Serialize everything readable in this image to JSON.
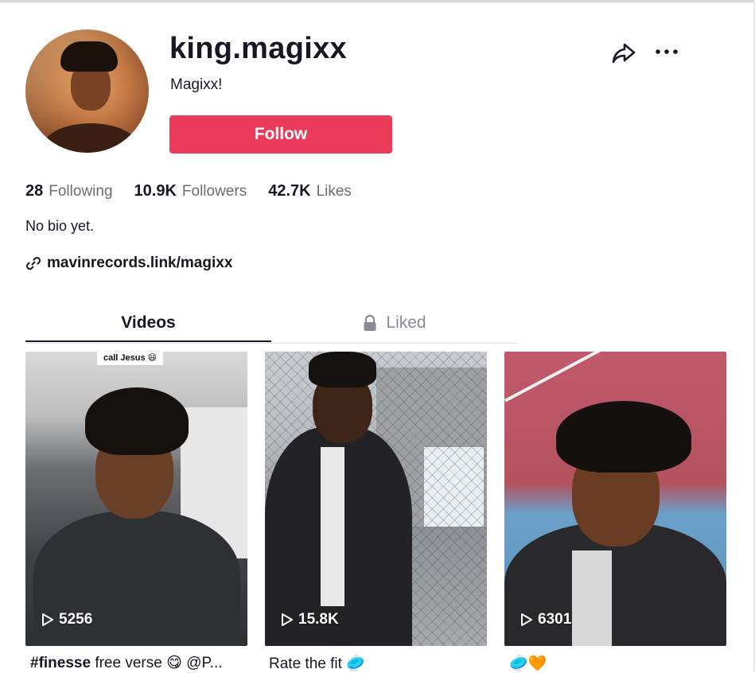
{
  "profile": {
    "username": "king.magixx",
    "nickname": "Magixx!",
    "follow_label": "Follow",
    "bio": "No bio yet.",
    "link": "mavinrecords.link/magixx"
  },
  "stats": [
    {
      "value": "28",
      "label": "Following"
    },
    {
      "value": "10.9K",
      "label": "Followers"
    },
    {
      "value": "42.7K",
      "label": "Likes"
    }
  ],
  "tabs": [
    {
      "label": "Videos",
      "active": true
    },
    {
      "label": "Liked",
      "locked": true
    }
  ],
  "videos": [
    {
      "plays": "5256",
      "overlay_text": "call Jesus 😄",
      "caption_tag": "#finesse",
      "caption_rest": " free verse 😋 @P..."
    },
    {
      "plays": "15.8K",
      "caption_tag": "",
      "caption_rest": "Rate the fit 🥏"
    },
    {
      "plays": "6301",
      "caption_tag": "",
      "caption_rest": "🥏🧡"
    }
  ],
  "icons": {
    "share": "share-icon",
    "more": "more-icon",
    "link": "link-icon",
    "lock": "lock-icon",
    "play": "play-icon"
  },
  "colors": {
    "follow_button": "#ea3b5a",
    "text_primary": "#161823",
    "text_secondary": "#6b6d74"
  }
}
